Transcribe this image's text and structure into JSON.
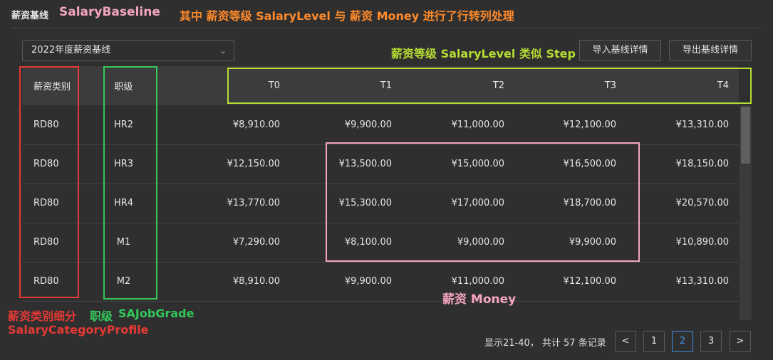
{
  "header": {
    "title": "薪资基线",
    "anno_title": "SalaryBaseline",
    "anno_desc": "其中 薪资等级 SalaryLevel 与 薪资 Money 进行了行转列处理"
  },
  "toolbar": {
    "select_value": "2022年度薪资基线",
    "anno_step": "薪资等级 SalaryLevel 类似 Step",
    "import_label": "导入基线详情",
    "export_label": "导出基线详情"
  },
  "table": {
    "headers": [
      "薪资类别",
      "职级",
      "T0",
      "T1",
      "T2",
      "T3",
      "T4"
    ],
    "rows": [
      [
        "RD80",
        "HR2",
        "¥8,910.00",
        "¥9,900.00",
        "¥11,000.00",
        "¥12,100.00",
        "¥13,310.00"
      ],
      [
        "RD80",
        "HR3",
        "¥12,150.00",
        "¥13,500.00",
        "¥15,000.00",
        "¥16,500.00",
        "¥18,150.00"
      ],
      [
        "RD80",
        "HR4",
        "¥13,770.00",
        "¥15,300.00",
        "¥17,000.00",
        "¥18,700.00",
        "¥20,570.00"
      ],
      [
        "RD80",
        "M1",
        "¥7,290.00",
        "¥8,100.00",
        "¥9,000.00",
        "¥9,900.00",
        "¥10,890.00"
      ],
      [
        "RD80",
        "M2",
        "¥8,910.00",
        "¥9,900.00",
        "¥11,000.00",
        "¥12,100.00",
        "¥13,310.00"
      ]
    ]
  },
  "annotations": {
    "money": "薪资 Money",
    "category_cn": "薪资类别细分",
    "category_en": "SalaryCategoryProfile",
    "grade_cn": "职级",
    "grade_en": "SAJobGrade"
  },
  "pagination": {
    "summary": "显示21-40， 共计 57 条记录",
    "prev": "<",
    "pages": [
      "1",
      "2",
      "3"
    ],
    "current": "2",
    "next": ">"
  },
  "colors": {
    "annotation_pink": "#f5a5bf",
    "annotation_orange": "#ff8a2a",
    "annotation_yellow": "#b6dd34",
    "annotation_red": "#e53935",
    "annotation_green": "#34c759",
    "active_page": "#3f8fe0"
  }
}
